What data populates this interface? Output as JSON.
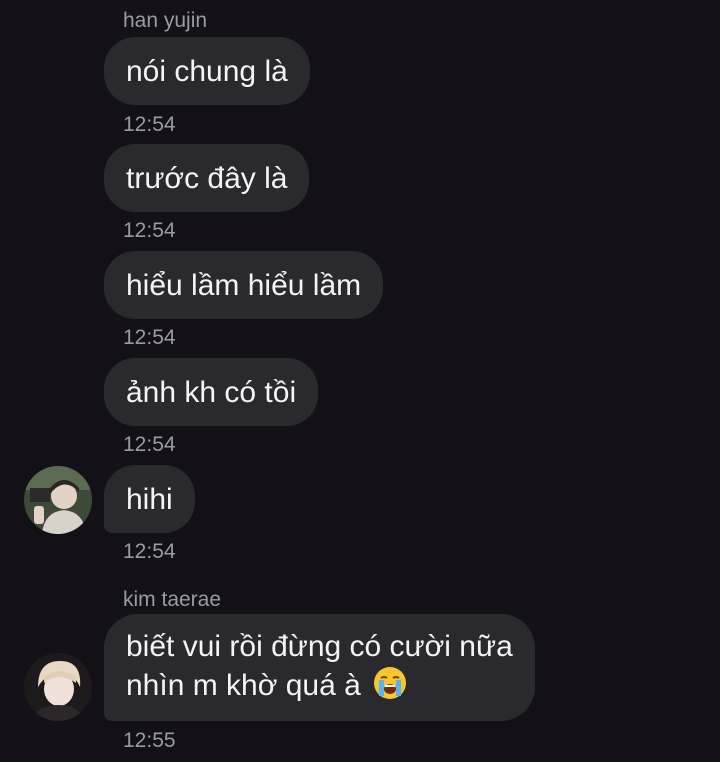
{
  "messages": [
    {
      "sender": "han yujin",
      "text": "nói chung là",
      "time": "12:54"
    },
    {
      "text": "trước đây là",
      "time": "12:54"
    },
    {
      "text": "hiểu lầm hiểu lầm",
      "time": "12:54"
    },
    {
      "text": "ảnh kh có tồi",
      "time": "12:54"
    },
    {
      "text": "hihi",
      "time": "12:54",
      "avatar": "avatar-han-yujin"
    },
    {
      "sender": "kim taerae",
      "lines": [
        "biết vui rồi đừng có cười nữa",
        "nhìn m khờ quá à"
      ],
      "emoji": "loudly-crying-face-emoji",
      "time": "12:55",
      "avatar": "avatar-kim-taerae"
    }
  ],
  "colors": {
    "background": "#141018",
    "bubble": "#2a2a2e",
    "text": "#f4f4f6",
    "meta": "#9a9aa3"
  }
}
